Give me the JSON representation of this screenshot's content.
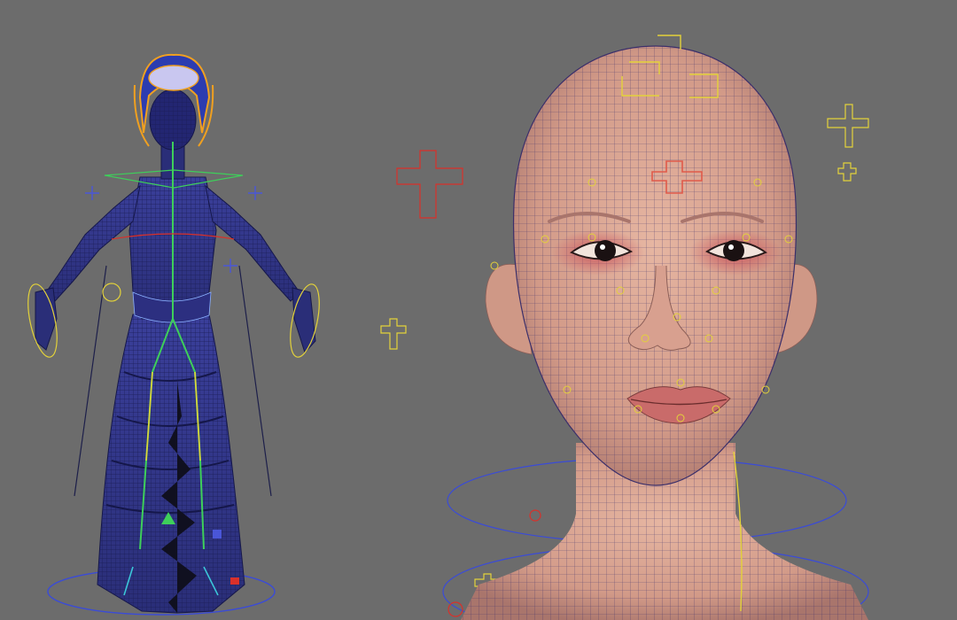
{
  "viewport": {
    "background": "#6c6c6c",
    "colors": {
      "mesh_blue": "#2b2f86",
      "mesh_dark": "#1d1f4a",
      "skin": "#d9a48f",
      "skin_shadow": "#b97f70",
      "eye_shadow": "#c8555a",
      "lips": "#c96b6a",
      "ctrl_yellow": "#e3d23a",
      "ctrl_red": "#d9302a",
      "ctrl_blue": "#4a56d8",
      "ctrl_green": "#3ecf5a",
      "ctrl_orange": "#f0a020",
      "ctrl_cyan": "#3bc6d8"
    }
  }
}
